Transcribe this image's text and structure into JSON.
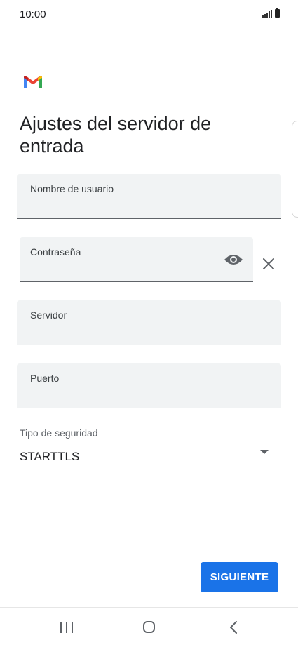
{
  "status_bar": {
    "time": "10:00",
    "icons": [
      "signal-icon",
      "battery-icon"
    ]
  },
  "app": {
    "logo": "gmail-logo",
    "title": "Ajustes del servidor de entrada"
  },
  "form": {
    "username": {
      "label": "Nombre de usuario",
      "value": ""
    },
    "password": {
      "label": "Contraseña",
      "value": "",
      "icons": [
        "eye-icon",
        "close-icon"
      ]
    },
    "server": {
      "label": "Servidor",
      "value": ""
    },
    "port": {
      "label": "Puerto",
      "value": ""
    },
    "security": {
      "label": "Tipo de seguridad",
      "value": "STARTTLS",
      "icon": "dropdown-arrow-icon"
    }
  },
  "actions": {
    "next_label": "SIGUIENTE"
  },
  "nav_bar": {
    "icons": [
      "recents-icon",
      "home-icon",
      "back-icon"
    ]
  },
  "colors": {
    "primary": "#1a73e8",
    "field_background": "#f1f3f4",
    "field_underline": "#5f6368",
    "gmail_red": "#ea4335",
    "gmail_blue": "#4285f4",
    "gmail_green": "#34a853",
    "gmail_yellow": "#fbbc04"
  }
}
